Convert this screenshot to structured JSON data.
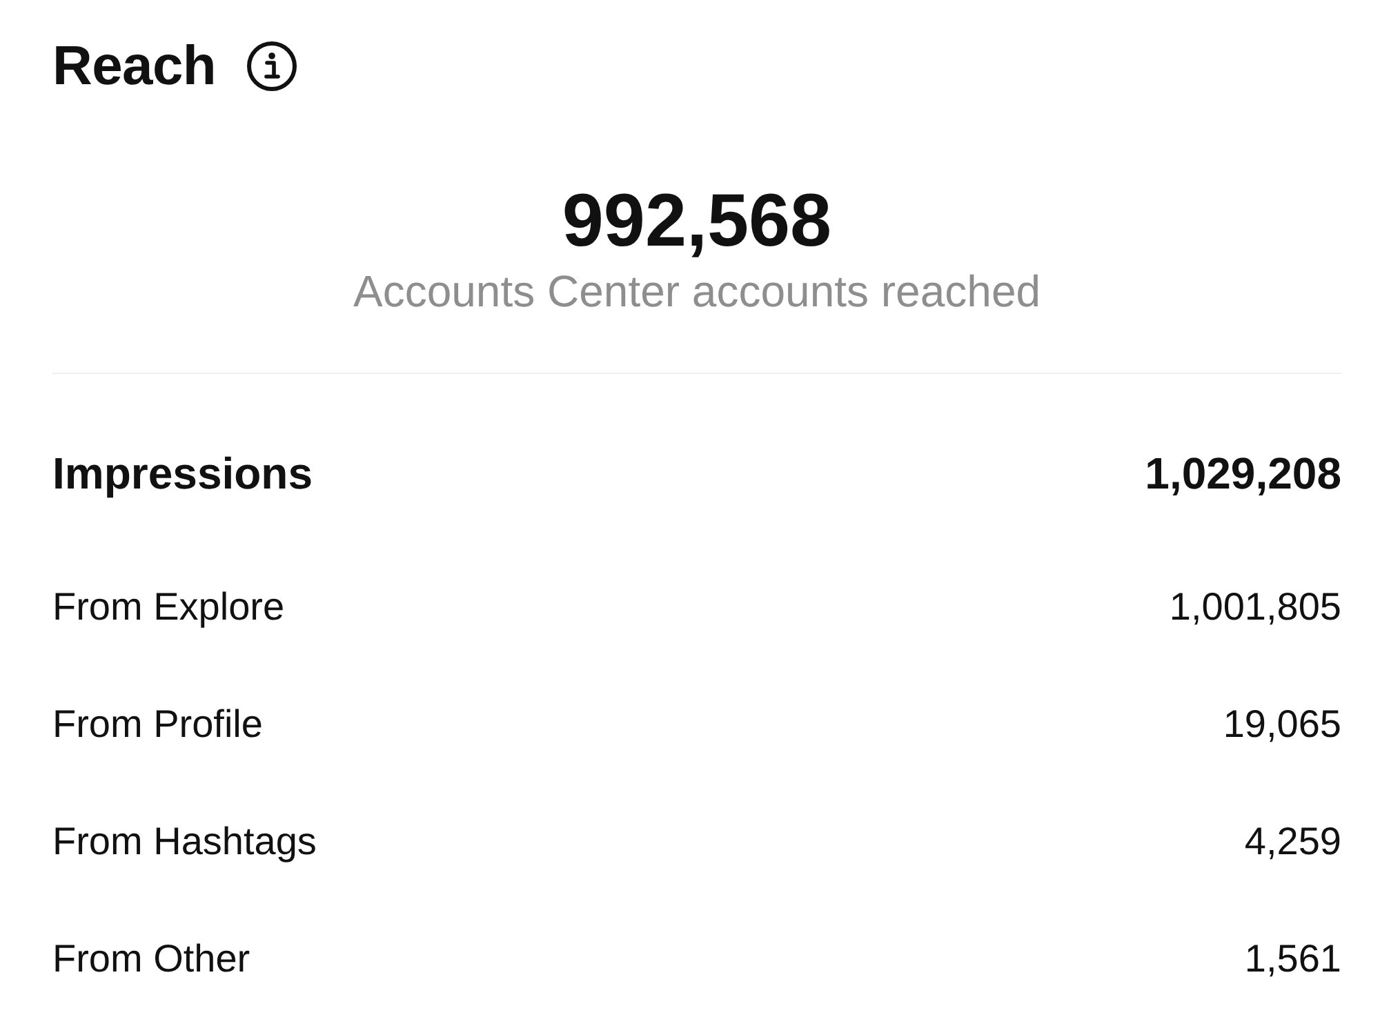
{
  "header": {
    "title": "Reach"
  },
  "summary": {
    "value": "992,568",
    "label": "Accounts Center accounts reached"
  },
  "impressions": {
    "label": "Impressions",
    "value": "1,029,208"
  },
  "sources": [
    {
      "label": "From Explore",
      "value": "1,001,805"
    },
    {
      "label": "From Profile",
      "value": "19,065"
    },
    {
      "label": "From Hashtags",
      "value": "4,259"
    },
    {
      "label": "From Other",
      "value": "1,561"
    }
  ]
}
